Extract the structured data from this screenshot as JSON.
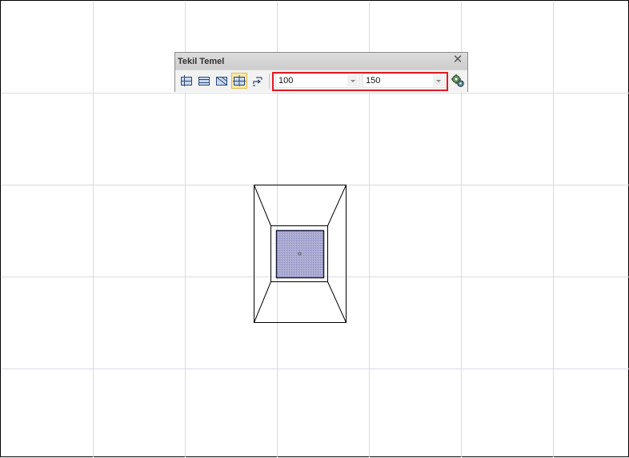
{
  "panel": {
    "title": "Tekil Temel",
    "close_glyph": "✕"
  },
  "tools": [
    {
      "name": "foundation-type-1-icon",
      "active": false
    },
    {
      "name": "foundation-type-2-icon",
      "active": false
    },
    {
      "name": "foundation-type-3-icon",
      "active": false
    },
    {
      "name": "foundation-type-4-icon",
      "active": true
    },
    {
      "name": "rotate-swap-icon",
      "active": false
    }
  ],
  "inputs": {
    "width_value": "100",
    "length_value": "150"
  },
  "settings_icon": "gears-icon",
  "colors": {
    "highlight": "#e01a22",
    "column_fill": "#a6a6cf",
    "column_stroke": "#1b1b3d",
    "grid": "#d9dbe0",
    "active_tool_bg": "#fbe9a6"
  }
}
